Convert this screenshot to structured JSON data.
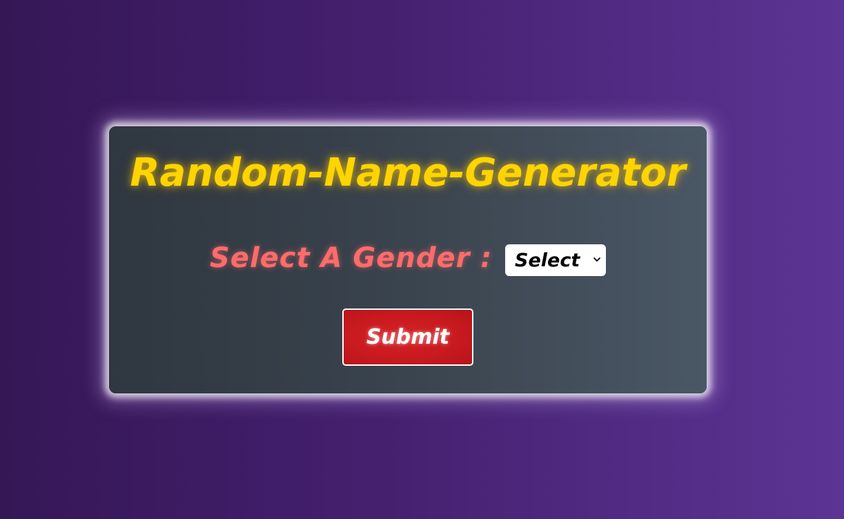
{
  "app": {
    "title": "Random-Name-Generator"
  },
  "form": {
    "gender_label": "Select A Gender :",
    "gender_select": {
      "selected": "Select",
      "icon": "chevron-down-icon"
    },
    "submit_label": "Submit"
  },
  "colors": {
    "title": "#ffd400",
    "label": "#ff6b6b",
    "button": "#c81a1f",
    "card_bg": "#3a444e",
    "page_bg_start": "#351756",
    "page_bg_end": "#5c3494"
  }
}
